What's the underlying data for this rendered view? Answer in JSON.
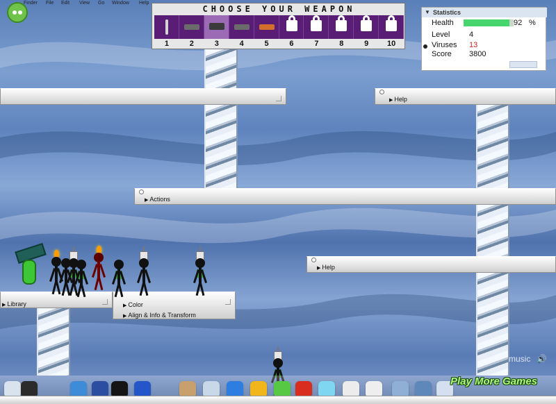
{
  "menubar": {
    "items": [
      "Finder",
      "File",
      "Edit",
      "View",
      "Go",
      "Window",
      "Help"
    ]
  },
  "weapon_selector": {
    "title": "CHOOSE YOUR WEAPON",
    "slots": [
      {
        "number": "1",
        "icon": "pencil-weapon-icon"
      },
      {
        "number": "2",
        "icon": "knife-weapon-icon"
      },
      {
        "number": "3",
        "icon": "hammer-weapon-icon",
        "selected": true
      },
      {
        "number": "4",
        "icon": "shotgun-weapon-icon"
      },
      {
        "number": "5",
        "icon": "flamethrower-weapon-icon"
      },
      {
        "number": "6",
        "icon": "lock-icon"
      },
      {
        "number": "7",
        "icon": "lock-icon"
      },
      {
        "number": "8",
        "icon": "lock-icon"
      },
      {
        "number": "9",
        "icon": "lock-icon"
      },
      {
        "number": "10",
        "icon": "lock-icon"
      }
    ]
  },
  "statistics": {
    "title": "Statistics",
    "health_label": "Health",
    "health_value": "92",
    "health_unit": "%",
    "level_label": "Level",
    "level_value": "4",
    "viruses_label": "Viruses",
    "viruses_value": "13",
    "score_label": "Score",
    "score_value": "3800"
  },
  "panels": {
    "top_left_label": "",
    "help_top": "Help",
    "actions": "Actions",
    "help_bottom": "Help",
    "library": "Library",
    "color": "Color",
    "align": "Align & Info & Transform"
  },
  "bottom": {
    "music": "music",
    "play_more": "Play More Games"
  }
}
